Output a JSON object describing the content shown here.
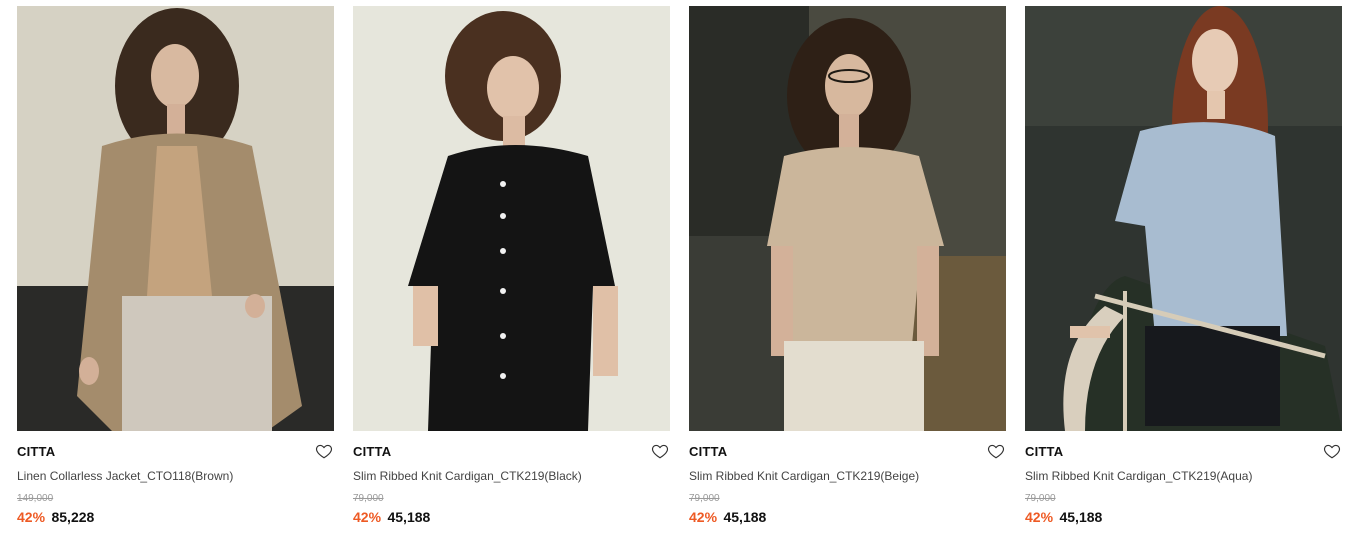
{
  "products": [
    {
      "brand": "CITTA",
      "name": "Linen Collarless Jacket_CTO118(Brown)",
      "original_price": "149,000",
      "discount": "42%",
      "price": "85,228",
      "image_alt": "Model wearing brown linen collarless jacket"
    },
    {
      "brand": "CITTA",
      "name": "Slim Ribbed Knit Cardigan_CTK219(Black)",
      "original_price": "79,000",
      "discount": "42%",
      "price": "45,188",
      "image_alt": "Model wearing black ribbed knit cardigan"
    },
    {
      "brand": "CITTA",
      "name": "Slim Ribbed Knit Cardigan_CTK219(Beige)",
      "original_price": "79,000",
      "discount": "42%",
      "price": "45,188",
      "image_alt": "Model wearing beige ribbed knit cardigan"
    },
    {
      "brand": "CITTA",
      "name": "Slim Ribbed Knit Cardigan_CTK219(Aqua)",
      "original_price": "79,000",
      "discount": "42%",
      "price": "45,188",
      "image_alt": "Model wearing aqua ribbed knit cardigan"
    }
  ],
  "wishlist_icon": "heart-outline-icon",
  "colors": {
    "discount": "#ee5a24",
    "price": "#111111",
    "original_price": "#9a9a9a"
  }
}
